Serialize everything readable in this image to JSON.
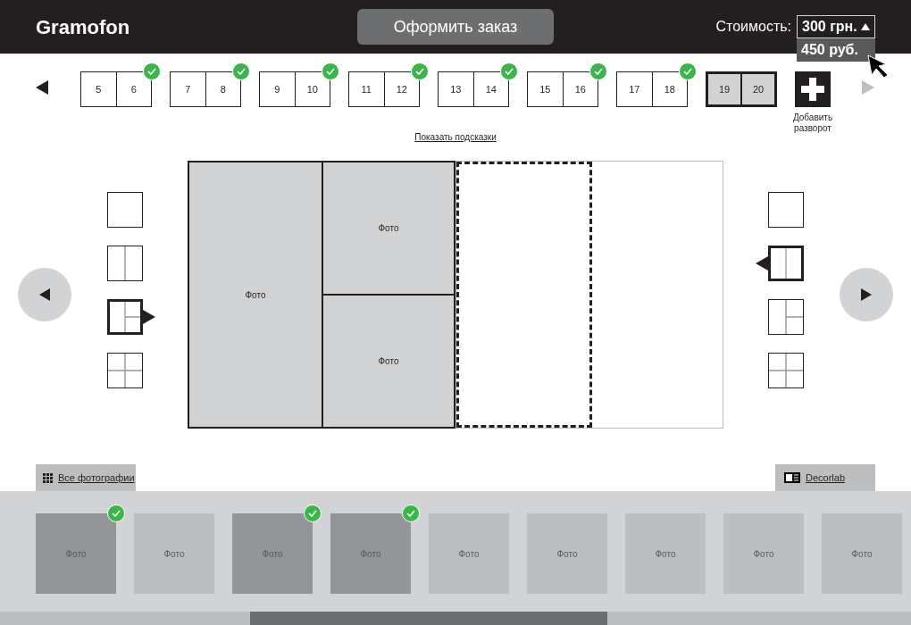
{
  "header": {
    "logo": "Gramofon",
    "order_button": "Оформить заказ",
    "cost_label": "Стоимость:",
    "cost_select": {
      "value": "300 грн.",
      "expanded": true,
      "options": [
        {
          "label": "450 руб.",
          "highlighted": true
        }
      ]
    }
  },
  "spread_nav": {
    "prev_disabled": false,
    "next_disabled": true
  },
  "spreads": [
    {
      "pages": [
        "5",
        "6"
      ],
      "done": true,
      "selected": false
    },
    {
      "pages": [
        "7",
        "8"
      ],
      "done": true,
      "selected": false
    },
    {
      "pages": [
        "9",
        "10"
      ],
      "done": true,
      "selected": false
    },
    {
      "pages": [
        "11",
        "12"
      ],
      "done": true,
      "selected": false
    },
    {
      "pages": [
        "13",
        "14"
      ],
      "done": true,
      "selected": false
    },
    {
      "pages": [
        "15",
        "16"
      ],
      "done": true,
      "selected": false
    },
    {
      "pages": [
        "17",
        "18"
      ],
      "done": true,
      "selected": false
    },
    {
      "pages": [
        "19",
        "20"
      ],
      "done": false,
      "selected": true
    }
  ],
  "add_spread": {
    "label": "Добавить разворот"
  },
  "hints_link": "Показать подсказки",
  "left_layouts": [
    {
      "kind": "single",
      "selected": false
    },
    {
      "kind": "two-columns",
      "selected": false
    },
    {
      "kind": "left-big-right-split",
      "selected": true
    },
    {
      "kind": "grid",
      "selected": false
    }
  ],
  "right_layouts": [
    {
      "kind": "single",
      "selected": false
    },
    {
      "kind": "two-columns",
      "selected": true
    },
    {
      "kind": "left-big-right-split",
      "selected": false
    },
    {
      "kind": "grid",
      "selected": false
    }
  ],
  "left_page": {
    "slots": [
      {
        "label": "Фото",
        "selected": false
      },
      {
        "label": "Фото",
        "selected": false
      },
      {
        "label": "Фото",
        "selected": false
      }
    ]
  },
  "right_page": {
    "slots": [
      {
        "selected": true
      },
      {
        "selected": false
      }
    ]
  },
  "photo_tabs": [
    {
      "kind": "all",
      "label": "Все фотографии"
    },
    {
      "kind": "decorlab",
      "label": "Decorlab"
    }
  ],
  "photos": [
    {
      "label": "Фото",
      "used": true
    },
    {
      "label": "Фото",
      "used": false
    },
    {
      "label": "Фото",
      "used": true
    },
    {
      "label": "Фото",
      "used": true
    },
    {
      "label": "Фото",
      "used": false
    },
    {
      "label": "Фото",
      "used": false
    },
    {
      "label": "Фото",
      "used": false
    },
    {
      "label": "Фото",
      "used": false
    },
    {
      "label": "Фото",
      "used": false
    }
  ]
}
